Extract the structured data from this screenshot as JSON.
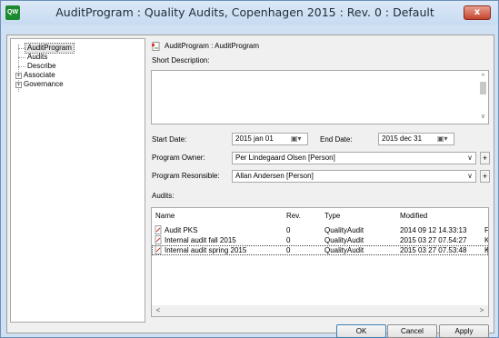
{
  "window": {
    "title": "AuditProgram : Quality Audits, Copenhagen 2015 : Rev. 0  : Default",
    "app_icon_text": "QW",
    "close_glyph": "x"
  },
  "tree": {
    "items": [
      {
        "label": "AuditProgram",
        "selected": true
      },
      {
        "label": "Audits"
      },
      {
        "label": "Describe"
      },
      {
        "label": "Associate",
        "expandable": true
      },
      {
        "label": "Governance",
        "expandable": true
      }
    ],
    "expander_glyph": "+"
  },
  "panel": {
    "breadcrumb": "AuditProgram : AuditProgram",
    "short_description_label": "Short Description:",
    "short_description_value": "",
    "start_date_label": "Start Date:",
    "start_date_value": "2015 jan 01",
    "end_date_label": "End Date:",
    "end_date_value": "2015 dec 31",
    "calendar_glyph": "▣▾",
    "program_owner_label": "Program Owner:",
    "program_owner_value": "Per Lindegaard Olsen [Person]",
    "program_responsible_label": "Program Resonsible:",
    "program_responsible_value": "Allan Andersen [Person]",
    "dropdown_glyph": "∨",
    "plus_glyph": "+",
    "audits_label": "Audits:"
  },
  "audits_table": {
    "columns": [
      "Name",
      "Rev.",
      "Type",
      "Modified"
    ],
    "rows": [
      {
        "name": "Audit PKS",
        "rev": "0",
        "type": "QualityAudit",
        "modified": "2014 09 12 14.33:13",
        "extra": "F"
      },
      {
        "name": "Internal audit fall 2015",
        "rev": "0",
        "type": "QualityAudit",
        "modified": "2015 03 27 07.54:27",
        "extra": "K"
      },
      {
        "name": "Internal audit spring 2015",
        "rev": "0",
        "type": "QualityAudit",
        "modified": "2015 03 27 07.53:48",
        "extra": "K"
      }
    ],
    "scroll_left": "<",
    "scroll_right": ">",
    "scroll_up": "^",
    "scroll_down": "v"
  },
  "buttons": {
    "ok": "OK",
    "cancel": "Cancel",
    "apply": "Apply"
  },
  "colors": {
    "window_frame": "#cfe0f3",
    "close_button": "#c5432c",
    "selection": "#e6e6e6"
  }
}
